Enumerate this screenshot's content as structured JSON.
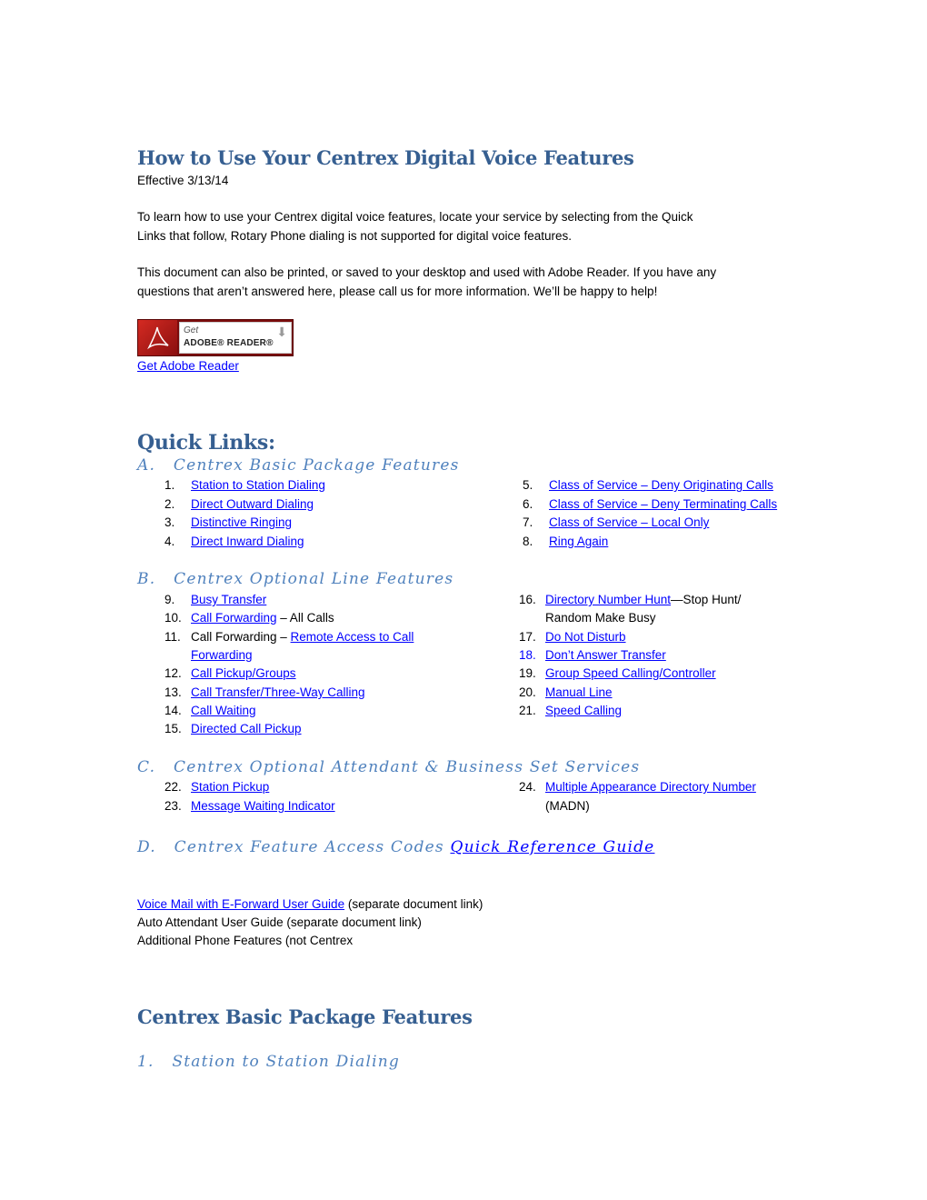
{
  "header": {
    "title": "How to Use Your Centrex Digital Voice Features",
    "effective": "Effective 3/13/14"
  },
  "intro": {
    "para1_line1": "To learn how to use your Centrex digital voice features, locate your service by selecting from the Quick",
    "para1_line2": "Links that follow, Rotary Phone dialing is not supported for digital voice features.",
    "para2_line1": "This document can also be printed, or saved to your desktop and used with Adobe Reader. If you have any",
    "para2_line2": "questions that aren’t answered here, please call us for more information. We’ll be happy to help!"
  },
  "adobe": {
    "badge_get": "Get",
    "badge_name": "ADOBE® READER®",
    "badge_icon": "download-arrow-icon",
    "link": "Get Adobe Reader"
  },
  "quick_links": {
    "heading": "Quick Links:",
    "section_a": {
      "heading": "A.   Centrex Basic Package Features",
      "items": [
        {
          "num": "1.",
          "text": "Station to Station Dialing"
        },
        {
          "num": "2.",
          "text": "Direct Outward Dialing"
        },
        {
          "num": "3.",
          "text": "Distinctive Ringing"
        },
        {
          "num": "4.",
          "text": "Direct Inward Dialing"
        },
        {
          "num": "5.",
          "text": "Class of Service – Deny Originating Calls"
        },
        {
          "num": "6.",
          "text": "Class of Service – Deny Terminating Calls"
        },
        {
          "num": "7.",
          "text": "Class of Service – Local Only"
        },
        {
          "num": "8.",
          "text": "Ring Again"
        }
      ]
    },
    "section_b": {
      "heading": "B.   Centrex Optional Line Features",
      "items": [
        {
          "num": "9.",
          "text": "Busy Transfer"
        },
        {
          "num": "10.",
          "link": "Call Forwarding",
          "suffix": " – All Calls"
        },
        {
          "num": "11.",
          "prefix": "Call Forwarding – ",
          "link": "Remote Access to Call",
          "link2": "Forwarding"
        },
        {
          "num": "12.",
          "text": "Call Pickup/Groups"
        },
        {
          "num": "13.",
          "text": "Call Transfer/Three-Way Calling"
        },
        {
          "num": "14.",
          "text": "Call Waiting"
        },
        {
          "num": "15.",
          "text": "Directed Call Pickup"
        },
        {
          "num": "16.",
          "link": "Directory Number Hunt",
          "suffix": "—Stop Hunt/",
          "line2": "Random Make Busy"
        },
        {
          "num": "17.",
          "text": "Do Not Disturb"
        },
        {
          "num": "18.",
          "text": "Don’t Answer Transfer"
        },
        {
          "num": "19.",
          "text": "Group Speed Calling/Controller"
        },
        {
          "num": "20.",
          "text": "Manual Line"
        },
        {
          "num": "21.",
          "text": "Speed Calling"
        }
      ]
    },
    "section_c": {
      "heading": "C.   Centrex Optional Attendant & Business Set Services",
      "items": [
        {
          "num": "22.",
          "text": "Station Pickup"
        },
        {
          "num": "23.",
          "text": "Message Waiting Indicator"
        },
        {
          "num": "24.",
          "text": "Multiple Appearance Directory Number",
          "line2": "(MADN)"
        }
      ]
    },
    "section_d": {
      "heading": "D.   Centrex Feature Access Codes ",
      "link": "Quick Reference Guide"
    }
  },
  "other_docs": {
    "voice_mail_link": "Voice Mail with E-Forward User Guide",
    "voice_mail_suffix": " (separate document link)",
    "auto_attendant": "Auto Attendant User Guide (separate document link)",
    "additional": "Additional Phone Features (not Centrex"
  },
  "basic_section": {
    "heading": "Centrex Basic Package Features",
    "subheading": "1.   Station to Station Dialing"
  }
}
